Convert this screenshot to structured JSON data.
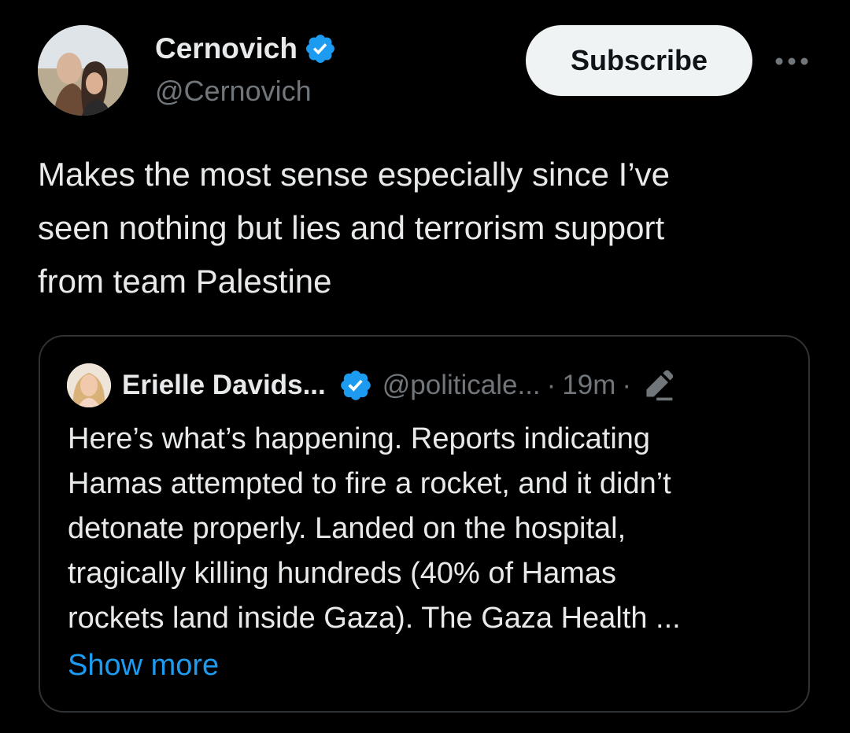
{
  "author": {
    "display_name": "Cernovich",
    "handle": "@Cernovich",
    "verified": true,
    "avatar_icon": "profile-photo"
  },
  "actions": {
    "subscribe_label": "Subscribe",
    "more_icon": "more-horizontal-icon"
  },
  "tweet": {
    "text": "Makes the most sense especially since I’ve\nseen nothing but lies and terrorism support\nfrom team Palestine"
  },
  "quote": {
    "display_name": "Erielle Davids...",
    "handle": "@politicale...",
    "separator": "·",
    "time": "19m",
    "edited_icon": "edit-pencil-icon",
    "verified": true,
    "text": "Here’s what’s happening. Reports indicating\nHamas attempted to fire a rocket, and it didn’t\ndetonate properly. Landed on the hospital,\ntragically killing hundreds (40% of Hamas\nrockets land inside Gaza). The Gaza Health ...",
    "show_more_label": "Show more"
  },
  "colors": {
    "background": "#000000",
    "text": "#e7e9ea",
    "secondary_text": "#71767b",
    "link": "#1d9bf0",
    "verified_badge": "#1d9bf0",
    "button_bg": "#eff3f4",
    "border": "#2f3336"
  }
}
